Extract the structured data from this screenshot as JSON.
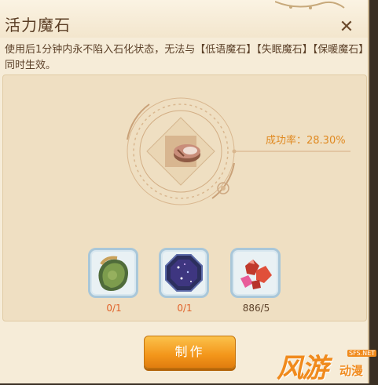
{
  "window": {
    "title": "活力魔石",
    "close_glyph": "✕"
  },
  "description": "使用后1分钟内永不陷入石化状态，无法与【低语魔石】【失眠魔石】【保暖魔石】同时生效。",
  "success_rate": "成功率：28.30%",
  "materials": [
    {
      "icon": "green-stone-icon",
      "count": "0/1",
      "count_color": "#e0622a"
    },
    {
      "icon": "starry-octagon-gem-icon",
      "count": "0/1",
      "count_color": "#e0622a"
    },
    {
      "icon": "red-crystal-cluster-icon",
      "count": "886/5",
      "count_color": "#5c4129"
    }
  ],
  "make_button": "制作",
  "watermark": {
    "big": "风游",
    "small": "动漫",
    "url": "SFS.NET"
  }
}
